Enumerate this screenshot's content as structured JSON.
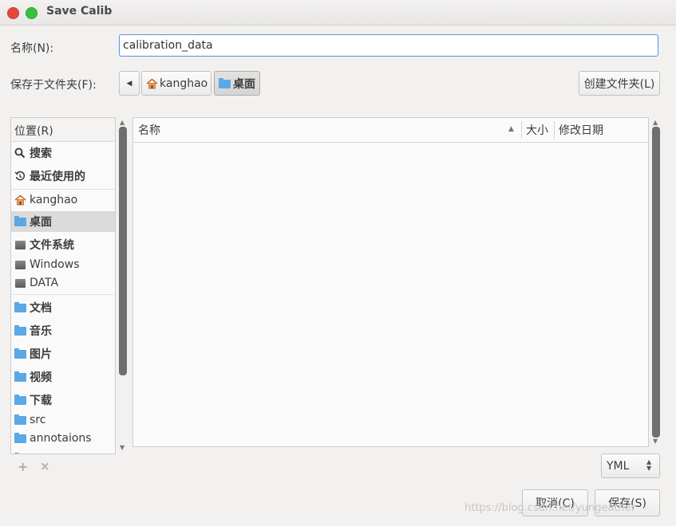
{
  "window": {
    "title": "Save Calib"
  },
  "name_field": {
    "label": "名称(N):",
    "value": "calibration_data"
  },
  "save_in": {
    "label": "保存于文件夹(F):",
    "crumbs": [
      "kanghao",
      "桌面"
    ],
    "create_folder_label": "创建文件夹(L)"
  },
  "sidebar": {
    "header": "位置(R)",
    "items": [
      {
        "label": "搜索",
        "icon": "search-icon"
      },
      {
        "label": "最近使用的",
        "icon": "recent-icon"
      },
      {
        "label": "kanghao",
        "icon": "home-icon"
      },
      {
        "label": "桌面",
        "icon": "folder-icon"
      },
      {
        "label": "文件系统",
        "icon": "drive-icon"
      },
      {
        "label": "Windows",
        "icon": "drive-icon"
      },
      {
        "label": "DATA",
        "icon": "drive-icon"
      },
      {
        "label": "文档",
        "icon": "folder-icon"
      },
      {
        "label": "音乐",
        "icon": "folder-icon"
      },
      {
        "label": "图片",
        "icon": "folder-icon"
      },
      {
        "label": "视频",
        "icon": "folder-icon"
      },
      {
        "label": "下载",
        "icon": "folder-icon"
      },
      {
        "label": "src",
        "icon": "folder-icon"
      },
      {
        "label": "annotaions",
        "icon": "folder-icon"
      }
    ],
    "add_glyph": "+",
    "remove_glyph": "×"
  },
  "filelist": {
    "columns": [
      "名称",
      "大小",
      "修改日期"
    ]
  },
  "filter": {
    "selected": "YML"
  },
  "buttons": {
    "cancel": "取消(C)",
    "save": "保存(S)"
  },
  "watermark": "https://blog.csdn.net/yungeather",
  "colors": {
    "accent": "#5294e2",
    "folder": "#5aa9e6",
    "close": "#e8453c",
    "maximize": "#35c142"
  }
}
